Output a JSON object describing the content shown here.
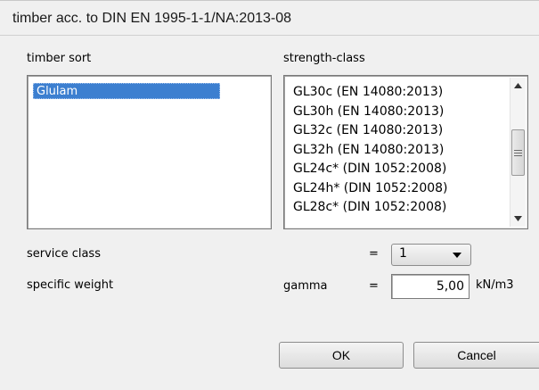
{
  "window": {
    "title": "timber acc. to DIN EN 1995-1-1/NA:2013-08"
  },
  "timber_sort": {
    "label": "timber sort",
    "items": [
      "Glulam"
    ],
    "selected": "Glulam"
  },
  "strength_class": {
    "label": "strength-class",
    "items": [
      "GL30c (EN 14080:2013)",
      "GL30h (EN 14080:2013)",
      "GL32c (EN 14080:2013)",
      "GL32h (EN 14080:2013)",
      "GL24c* (DIN 1052:2008)",
      "GL24h* (DIN 1052:2008)",
      "GL28c* (DIN 1052:2008)"
    ],
    "scroll_up_icon": "arrow-up-icon",
    "scroll_down_icon": "arrow-down-icon",
    "scroll_grip_icon": "grip-icon"
  },
  "service_class": {
    "label": "service class",
    "equals": "=",
    "value": "1",
    "dropdown_icon": "chevron-down-icon"
  },
  "specific_weight": {
    "label": "specific weight",
    "symbol": "gamma",
    "equals": "=",
    "value": "5,00",
    "unit": "kN/m3"
  },
  "buttons": {
    "ok_label": "OK",
    "cancel_label": "Cancel"
  },
  "colors": {
    "selection": "#3c7fd0",
    "dialog_bg": "#f0f0f0"
  }
}
